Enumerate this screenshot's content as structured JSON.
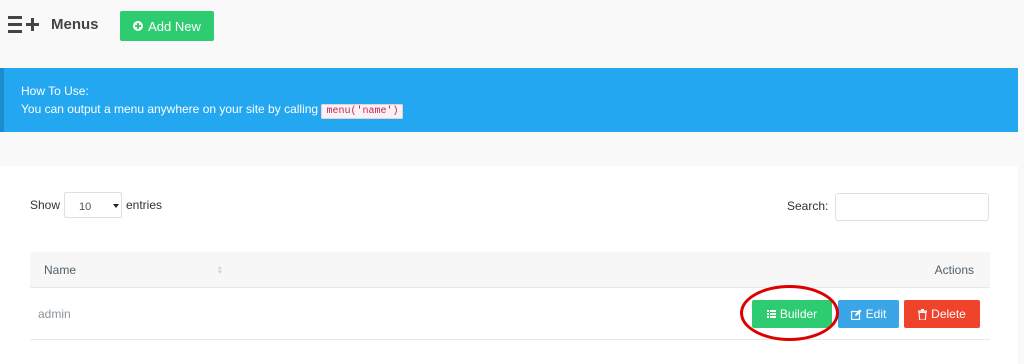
{
  "header": {
    "title": "Menus",
    "add_new_label": "Add New"
  },
  "alert": {
    "heading": "How To Use:",
    "text": "You can output a menu anywhere on your site by calling",
    "code": "menu('name')"
  },
  "table_controls": {
    "show_label": "Show",
    "page_length": "10",
    "entries_label": "entries",
    "search_label": "Search:",
    "search_value": ""
  },
  "table": {
    "columns": [
      "Name",
      "Actions"
    ],
    "rows": [
      {
        "name": "admin",
        "actions": [
          "Builder",
          "Edit",
          "Delete"
        ]
      }
    ]
  },
  "colors": {
    "success": "#2ecc71",
    "info": "#22a7f0",
    "primary": "#3aa6e8",
    "danger": "#f0432c",
    "annotation": "#dd0000"
  },
  "icons": [
    "menu-plus-icon",
    "plus-circle-icon",
    "sort-icon",
    "list-icon",
    "edit-icon",
    "trash-icon"
  ]
}
